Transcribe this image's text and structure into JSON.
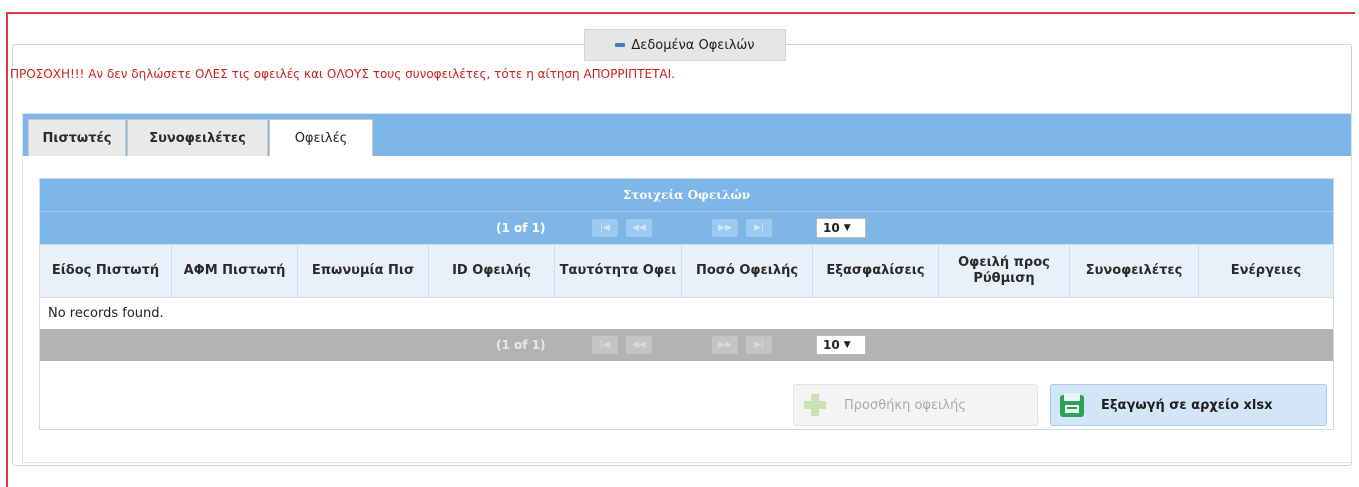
{
  "section": {
    "legend_label": "Δεδομένα Οφειλών",
    "warning": "ΠΡΟΣΟΧΗ!!! Αν δεν δηλώσετε ΟΛΕΣ τις οφειλές και ΟΛΟΥΣ τους συνοφειλέτες, τότε η αίτηση ΑΠΟΡΡΙΠΤΕΤΑΙ."
  },
  "tabs": [
    {
      "label": "Πιστωτές"
    },
    {
      "label": "Συνοφειλέτες"
    },
    {
      "label": "Οφειλές"
    }
  ],
  "grid": {
    "title": "Στοιχεία Οφειλών",
    "paginator": {
      "current": "(1 of 1)",
      "rows_per_page": "10",
      "first_icon": "first-page-icon",
      "prev_icon": "prev-page-icon",
      "next_icon": "next-page-icon",
      "last_icon": "last-page-icon"
    },
    "columns": [
      "Είδος Πιστωτή",
      "ΑΦΜ Πιστωτή",
      "Επωνυμία Πισ",
      "ID Οφειλής",
      "Ταυτότητα Οφει",
      "Ποσό Οφειλής",
      "Εξασφαλίσεις",
      "Οφειλή προς Ρύθμιση",
      "Συνοφειλέτες",
      "Ενέργειες"
    ],
    "empty_message": "No records found."
  },
  "actions": {
    "add_label": "Προσθήκη οφειλής",
    "add_icon": "plus-icon",
    "export_label": "Εξαγωγή σε αρχείο xlsx",
    "export_icon": "export-xlsx-icon"
  },
  "colors": {
    "accent": "#7fb6e8",
    "warning": "#cc1f1f",
    "border": "#e23a3a"
  }
}
